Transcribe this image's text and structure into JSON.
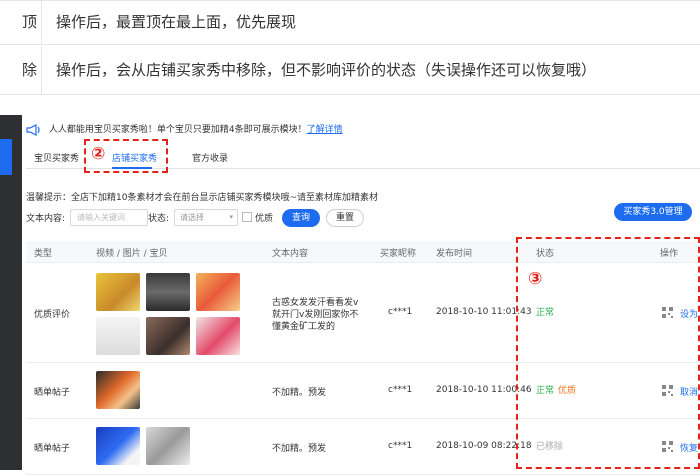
{
  "description_table": {
    "rows": [
      {
        "left_text": "顶",
        "text": "操作后，最置顶在最上面，优先展现"
      },
      {
        "left_text": "除",
        "text": "操作后，会从店铺买家秀中移除，但不影响评价的状态（失误操作还可以恢复哦）"
      }
    ]
  },
  "notice": {
    "text": "人人都能用宝贝买家秀啦！单个宝贝只要加精4条即可展示模块！",
    "link": "了解详情"
  },
  "tabs": [
    "宝贝买家秀",
    "店铺买家秀",
    "官方收录"
  ],
  "active_tab": "店铺买家秀",
  "tip": "温馨提示：全店下加精10条素材才会在前台显示店铺买家秀模块哦~请至素材库加精素材",
  "filter": {
    "content_label": "文本内容:",
    "content_placeholder": "请输入关键词",
    "status_label": "状态:",
    "status_value": "请选择",
    "quality_label": "优质",
    "query_button": "查询",
    "reset_button": "重置"
  },
  "buyer_show_button": "买家秀3.0管理",
  "table": {
    "headers": [
      "类型",
      "视频 / 图片 / 宝贝",
      "文本内容",
      "买家昵称",
      "发布时间",
      "状态",
      "操作"
    ],
    "rows": [
      {
        "type": "优质评价",
        "text_lines": [
          "古惑女发发汗看看发v",
          "就开门v发刚回家你不",
          "懂黄金矿工发的"
        ],
        "nickname": "c***1",
        "time": "2018-10-10 11:01:43",
        "status": "正常",
        "status_extra": "",
        "operation": "设为"
      },
      {
        "type": "晒单帖子",
        "text_lines": [
          "不加精。预发"
        ],
        "nickname": "c***1",
        "time": "2018-10-10 11:00:46",
        "status": "正常",
        "status_extra": "优质",
        "operation": "取消"
      },
      {
        "type": "晒单帖子",
        "text_lines": [
          "不加精。预发"
        ],
        "nickname": "c***1",
        "time": "2018-10-09 08:22:18",
        "status": "已移除",
        "status_extra": "",
        "operation": "恢复"
      }
    ]
  },
  "annotations": {
    "two": "②",
    "three": "③"
  },
  "colors": {
    "accent": "#1d6cf0",
    "annotation_red": "#e2231a",
    "status_ok": "#2fae4f",
    "status_star": "#f2731f"
  }
}
